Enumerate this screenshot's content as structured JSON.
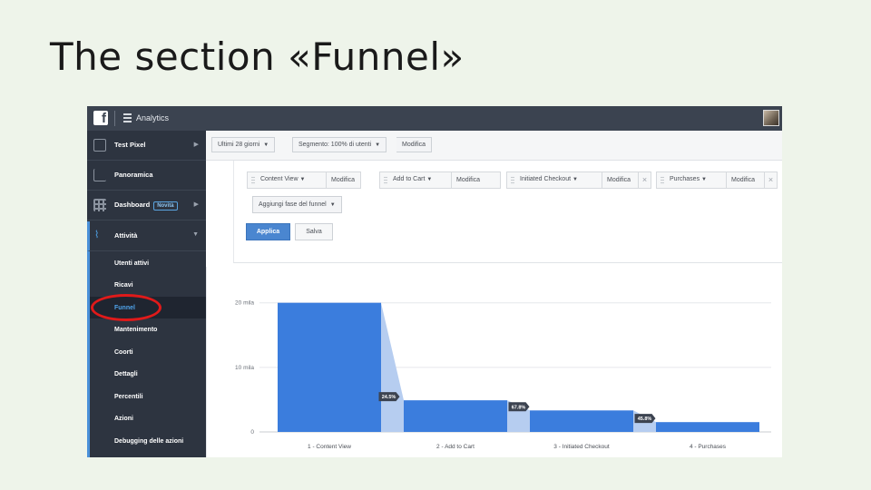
{
  "slide": {
    "title": "The section «Funnel»"
  },
  "app": {
    "title": "Analytics"
  },
  "sidebar": {
    "items": [
      {
        "label": "Test Pixel"
      },
      {
        "label": "Panoramica"
      },
      {
        "label": "Dashboard",
        "badge": "Novità"
      },
      {
        "label": "Attività"
      }
    ],
    "subitems": [
      {
        "label": "Utenti attivi"
      },
      {
        "label": "Ricavi"
      },
      {
        "label": "Funnel"
      },
      {
        "label": "Mantenimento"
      },
      {
        "label": "Coorti"
      },
      {
        "label": "Dettagli"
      },
      {
        "label": "Percentili"
      },
      {
        "label": "Azioni"
      },
      {
        "label": "Debugging delle azioni"
      }
    ]
  },
  "toolbar": {
    "date_range": "Ultimi 28 giorni",
    "segment": "Segmento: 100% di utenti",
    "edit": "Modifica"
  },
  "funnel": {
    "steps": [
      {
        "name": "Content View",
        "edit": "Modifica"
      },
      {
        "name": "Add to Cart",
        "edit": "Modifica"
      },
      {
        "name": "Initiated Checkout",
        "edit": "Modifica"
      },
      {
        "name": "Purchases",
        "edit": "Modifica"
      }
    ],
    "add_step": "Aggiungi fase del funnel",
    "apply": "Applica",
    "save": "Salva"
  },
  "colors": {
    "bar": "#3b7ddd",
    "dropoff": "#b6cdf0",
    "accent": "#4a90d9",
    "highlight": "#e01a1a"
  },
  "chart_data": {
    "type": "bar",
    "categories": [
      "1 - Content View",
      "2 - Add to Cart",
      "3 - Initiated Checkout",
      "4 - Purchases"
    ],
    "values": [
      20000,
      4900,
      3330,
      1520
    ],
    "conversion_labels": [
      "24.5%",
      "67.8%",
      "45.8%"
    ],
    "y_ticks": [
      "0",
      "10 mila",
      "20 mila"
    ],
    "ylim": [
      0,
      20800
    ],
    "grid": true,
    "title": "",
    "xlabel": "",
    "ylabel": ""
  }
}
